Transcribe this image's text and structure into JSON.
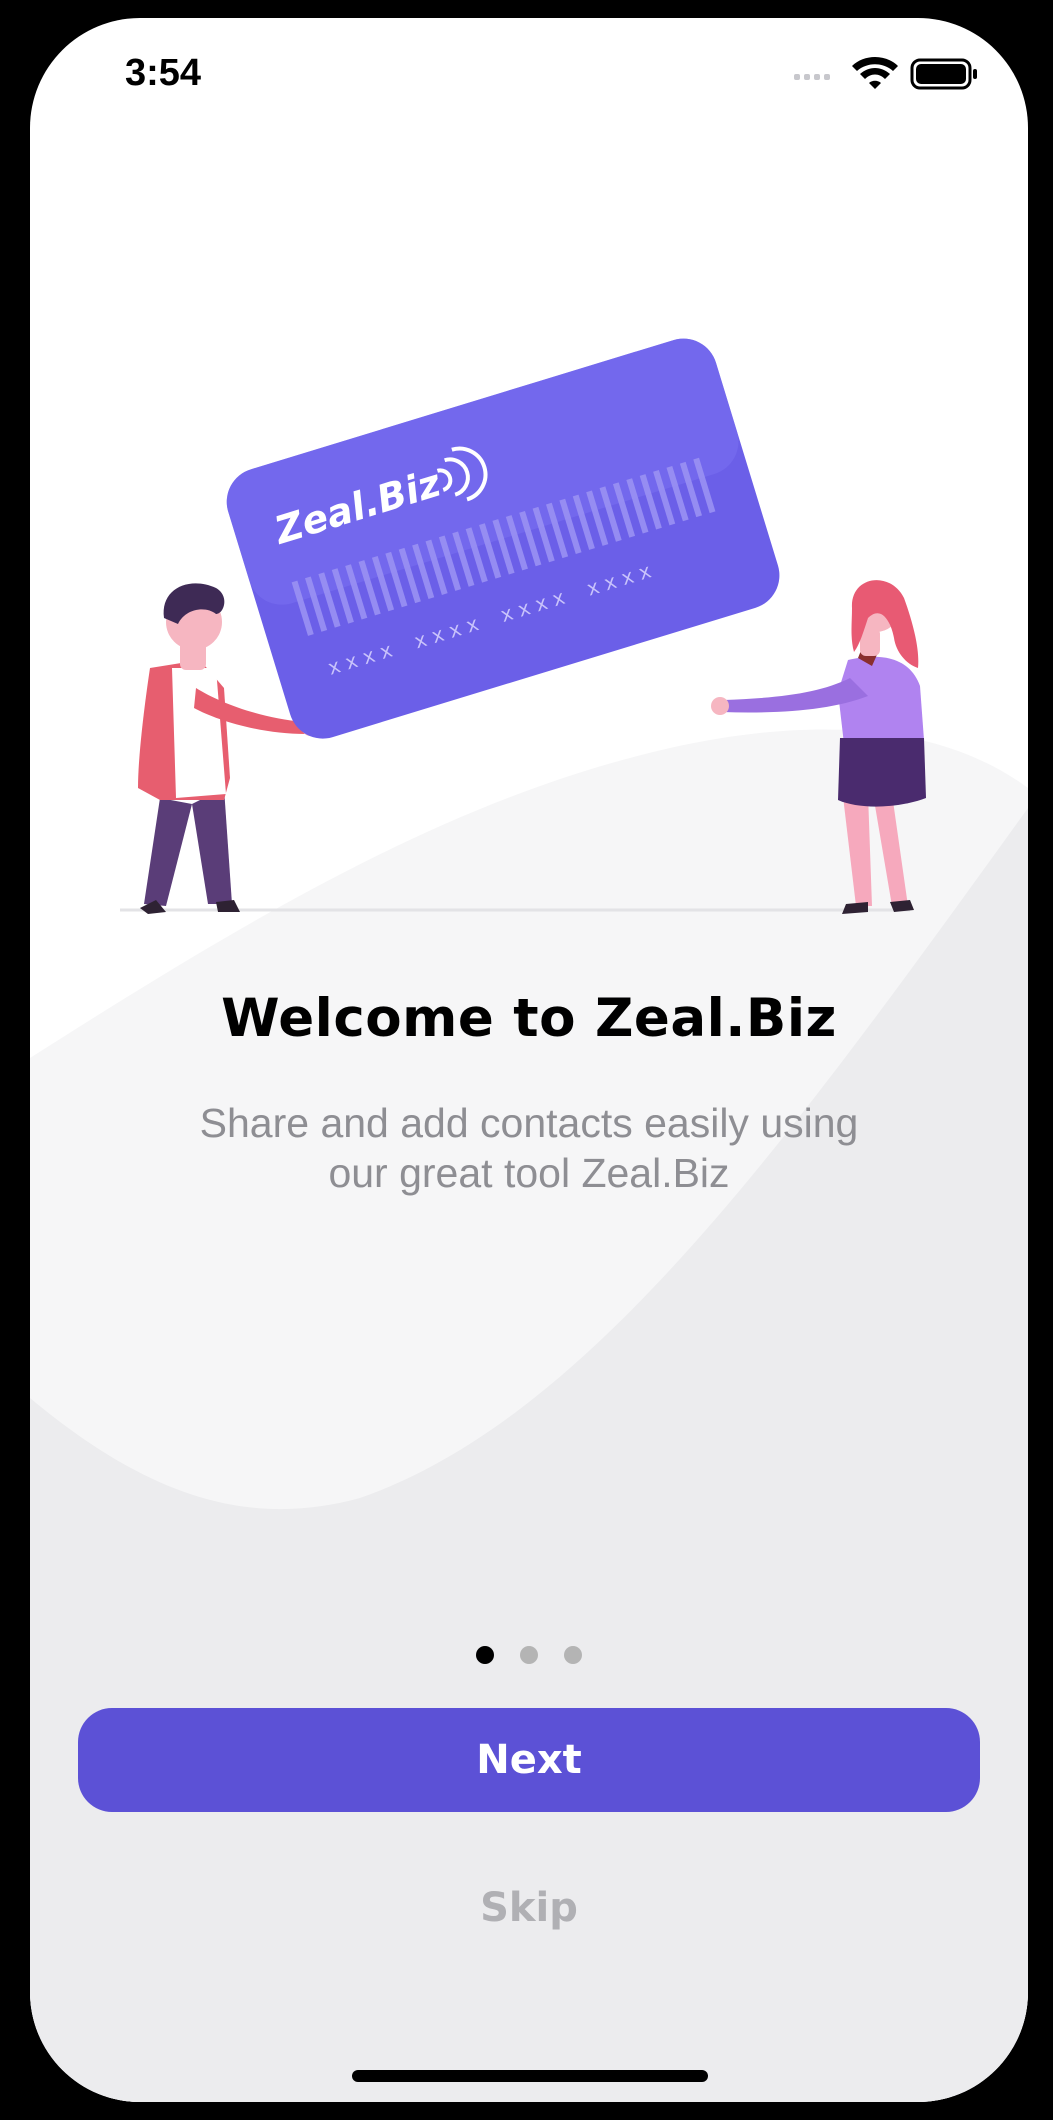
{
  "status_bar": {
    "time": "3:54",
    "icons": [
      "cellular-signal-icon",
      "wifi-icon",
      "battery-icon"
    ]
  },
  "illustration": {
    "card_brand": "Zeal.Biz",
    "card_number": "xxxx  xxxx  xxxx  xxxx"
  },
  "onboarding": {
    "title": "Welcome to Zeal.Biz",
    "subtitle_line1": "Share and add contacts easily using",
    "subtitle_line2": "our great tool Zeal.Biz",
    "page_indicator": {
      "pages": 3,
      "active": 1
    }
  },
  "actions": {
    "next_label": "Next",
    "skip_label": "Skip"
  },
  "colors": {
    "primary": "#5c51d6",
    "card": "#6b5fe8",
    "subtitle": "#8e8e93",
    "background_wave": "#ececee"
  }
}
